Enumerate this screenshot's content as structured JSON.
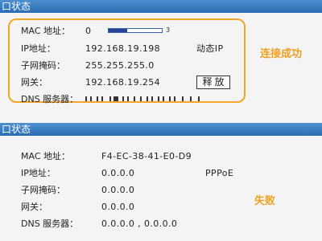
{
  "top_panel": {
    "header_title": "口状态",
    "rows": {
      "mac": {
        "label": "MAC 地址：",
        "value": "0"
      },
      "ip": {
        "label": "IP地址：",
        "value": "192.168.19.198",
        "type": "动态IP"
      },
      "subnet": {
        "label": "子网掩码：",
        "value": "255.255.255.0"
      },
      "gateway": {
        "label": "网关：",
        "value": "192.168.19.254",
        "button": "释放"
      },
      "dns": {
        "label": "DNS 服务器："
      }
    },
    "progress_fraction": 0.35,
    "annotation": "连接成功",
    "accent_color": "#f4a52a"
  },
  "bottom_panel": {
    "header_title": "口状态",
    "rows": {
      "mac": {
        "label": "MAC 地址：",
        "value": "F4-EC-38-41-E0-D9"
      },
      "ip": {
        "label": "IP地址：",
        "value": "0.0.0.0",
        "type": "PPPoE"
      },
      "subnet": {
        "label": "子网掩码：",
        "value": "0.0.0.0"
      },
      "gateway": {
        "label": "网关：",
        "value": "0.0.0.0"
      },
      "dns": {
        "label": "DNS 服务器：",
        "value": "0.0.0.0 , 0.0.0.0"
      }
    },
    "annotation": "失败",
    "accent_color": "#f0a020"
  },
  "colors": {
    "header_blue": "#2a6db4",
    "progress_blue": "#23449a"
  }
}
